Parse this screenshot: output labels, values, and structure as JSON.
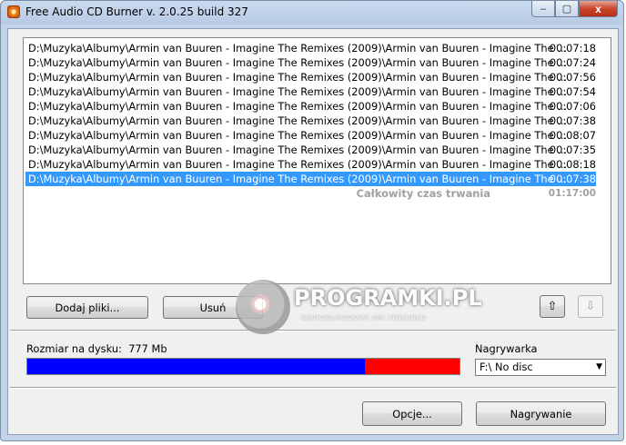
{
  "window": {
    "title": "Free Audio CD Burner  v. 2.0.25 build 327",
    "icon": "cd-burner-icon"
  },
  "caption": {
    "minimize": "–",
    "maximize": "▢",
    "close": "x"
  },
  "tracks": [
    {
      "path": "D:\\Muzyka\\Albumy\\Armin van Buuren - Imagine The Remixes (2009)\\Armin van Buuren - Imagine The ...",
      "duration": "00:07:18"
    },
    {
      "path": "D:\\Muzyka\\Albumy\\Armin van Buuren - Imagine The Remixes (2009)\\Armin van Buuren - Imagine The ...",
      "duration": "00:07:24"
    },
    {
      "path": "D:\\Muzyka\\Albumy\\Armin van Buuren - Imagine The Remixes (2009)\\Armin van Buuren - Imagine The ...",
      "duration": "00:07:56"
    },
    {
      "path": "D:\\Muzyka\\Albumy\\Armin van Buuren - Imagine The Remixes (2009)\\Armin van Buuren - Imagine The ...",
      "duration": "00:07:54"
    },
    {
      "path": "D:\\Muzyka\\Albumy\\Armin van Buuren - Imagine The Remixes (2009)\\Armin van Buuren - Imagine The ...",
      "duration": "00:07:06"
    },
    {
      "path": "D:\\Muzyka\\Albumy\\Armin van Buuren - Imagine The Remixes (2009)\\Armin van Buuren - Imagine The ...",
      "duration": "00:07:38"
    },
    {
      "path": "D:\\Muzyka\\Albumy\\Armin van Buuren - Imagine The Remixes (2009)\\Armin van Buuren - Imagine The ...",
      "duration": "00:08:07"
    },
    {
      "path": "D:\\Muzyka\\Albumy\\Armin van Buuren - Imagine The Remixes (2009)\\Armin van Buuren - Imagine The ...",
      "duration": "00:07:35"
    },
    {
      "path": "D:\\Muzyka\\Albumy\\Armin van Buuren - Imagine The Remixes (2009)\\Armin van Buuren - Imagine The ...",
      "duration": "00:08:18"
    },
    {
      "path": "D:\\Muzyka\\Albumy\\Armin van Buuren - Imagine The Remixes (2009)\\Armin van Buuren - Imagine The ...",
      "duration": "00:07:38",
      "selected": true
    }
  ],
  "total": {
    "label": "Całkowity czas trwania",
    "duration": "01:17:00"
  },
  "buttons": {
    "add_files": "Dodaj pliki...",
    "remove": "Usuń",
    "move_up": "⇧",
    "move_down": "⇩",
    "options": "Opcje...",
    "burn": "Nagrywanie"
  },
  "disk": {
    "size_label": "Rozmiar na dysku:",
    "size_value": "777 Mb",
    "used_fraction": 0.78,
    "used_color": "#0000ff",
    "free_color": "#ff0000"
  },
  "burner": {
    "label": "Nagrywarka",
    "selected": "F:\\ No disc"
  },
  "watermark": {
    "text": "PROGRAMKI.PL",
    "subtext": "DARMOWE PROGRAMY, GRY, STEROWNIKI"
  }
}
